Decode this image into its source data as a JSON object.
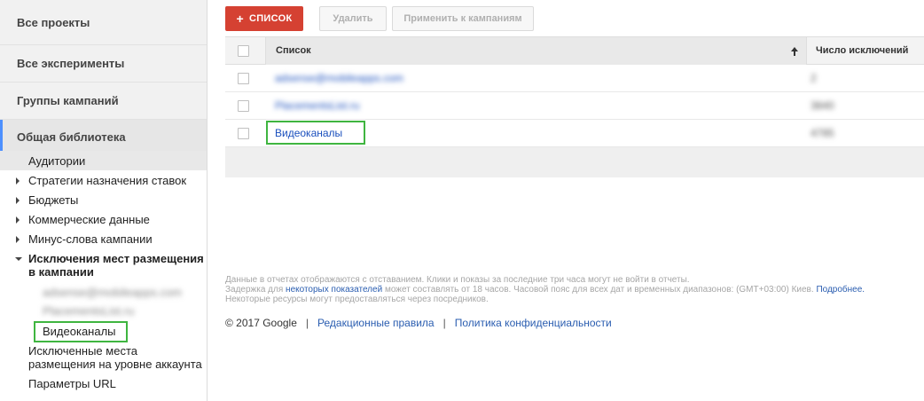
{
  "sidebar": {
    "nav": [
      {
        "label": "Все проекты"
      },
      {
        "label": "Все эксперименты"
      },
      {
        "label": "Группы кампаний"
      },
      {
        "label": "Общая библиотека"
      }
    ],
    "library": {
      "audiences": "Аудитории",
      "bid_strategies": "Стратегии назначения ставок",
      "budgets": "Бюджеты",
      "business_data": "Коммерческие данные",
      "negative_keywords": "Минус-слова кампании",
      "placement_exclusions": "Исключения мест размещения в кампании",
      "exclusion_list_1": "adsense@mobileapps.com",
      "exclusion_list_2": "PlacementsList.ru",
      "video_channels": "Видеоканалы",
      "account_excluded_placements": "Исключенные места размещения на уровне аккаунта",
      "url_params": "Параметры URL"
    }
  },
  "toolbar": {
    "add_label": "СПИСОК",
    "delete_label": "Удалить",
    "apply_label": "Применить к кампаниям"
  },
  "table": {
    "headers": {
      "name": "Список",
      "count": "Число исключений"
    },
    "rows": [
      {
        "name": "adsense@mobileapps.com",
        "count": "2",
        "blurred": true
      },
      {
        "name": "PlacementsList.ru",
        "count": "3840",
        "blurred": true
      },
      {
        "name": "Видеоканалы",
        "count": "4785",
        "blurred": false
      }
    ]
  },
  "notice": {
    "line1": "Данные в отчетах отображаются с отставанием. Клики и показы за последние три часа могут не войти в отчеты.",
    "line2_pre": "Задержка для ",
    "line2_link1": "некоторых",
    "line2_link2": "показателей",
    "line2_post": " может составлять от 18 часов. Часовой пояс для всех дат и временных диапазонов: (GMT+03:00) Киев. ",
    "line2_more": "Подробнее.",
    "line3": "Некоторые ресурсы могут предоставляться через посредников."
  },
  "footer": {
    "copyright": "© 2017 Google",
    "separator": "|",
    "policy_link": "Редакционные правила",
    "privacy_link": "Политика конфиденциальности"
  },
  "colors": {
    "accent_red": "#d54132",
    "link_blue": "#1a4fbd",
    "highlight_green": "#3fb540"
  }
}
